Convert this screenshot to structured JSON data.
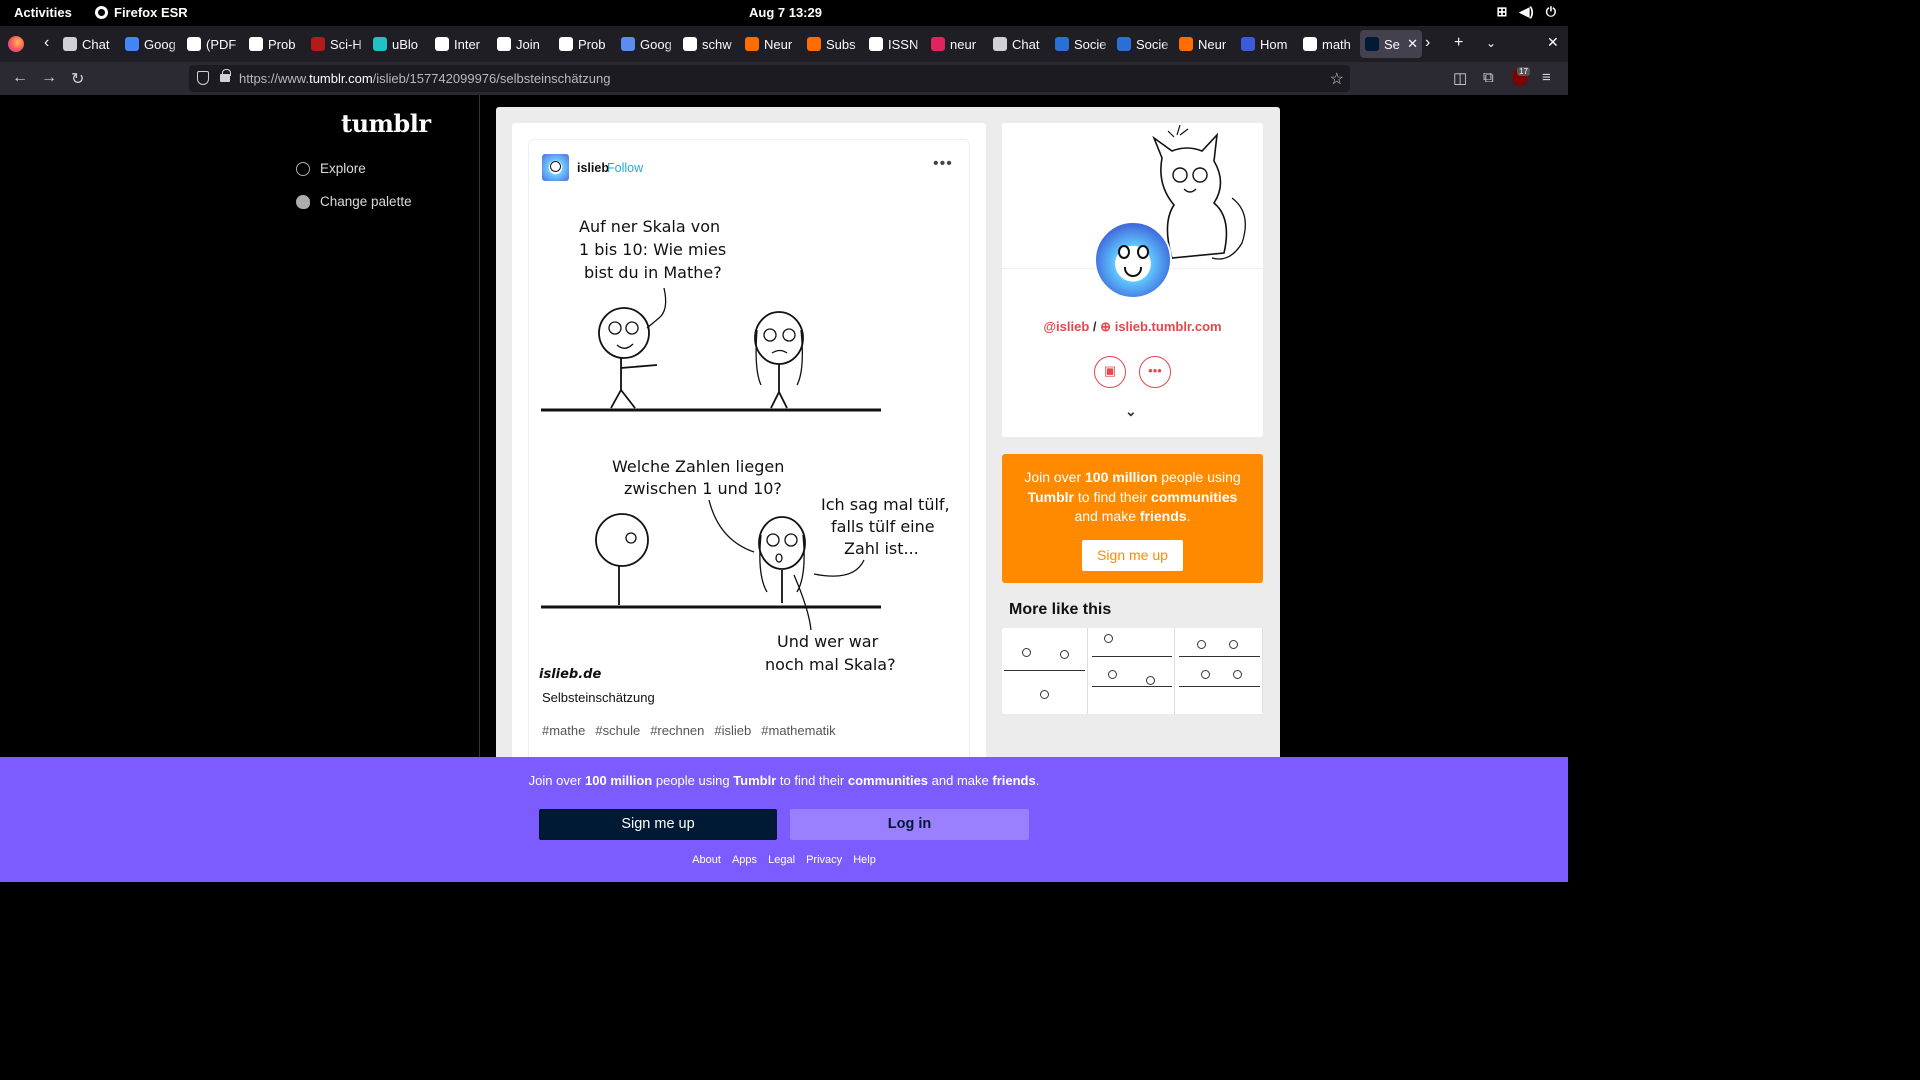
{
  "system": {
    "activities": "Activities",
    "app_name": "Firefox ESR",
    "clock": "Aug 7  13:29"
  },
  "browser": {
    "tabs": [
      {
        "label": "Chat",
        "color": "#d0d0d6"
      },
      {
        "label": "Goog",
        "color": "#4285f4"
      },
      {
        "label": "(PDF",
        "color": "#ffffff"
      },
      {
        "label": "Prob",
        "color": "#ffffff"
      },
      {
        "label": "Sci-H",
        "color": "#b31b1b"
      },
      {
        "label": "uBlo",
        "color": "#22c1c3"
      },
      {
        "label": "Inter",
        "color": "#ffffff"
      },
      {
        "label": "Join",
        "color": "#ffffff"
      },
      {
        "label": "Prob",
        "color": "#ffffff"
      },
      {
        "label": "Goog",
        "color": "#5b8def"
      },
      {
        "label": "schw",
        "color": "#ffffff"
      },
      {
        "label": "Neur",
        "color": "#ff6c00"
      },
      {
        "label": "Subs",
        "color": "#ff6c00"
      },
      {
        "label": "ISSN",
        "color": "#ffffff"
      },
      {
        "label": "neur",
        "color": "#e0245e"
      },
      {
        "label": "Chat",
        "color": "#d0d0d6"
      },
      {
        "label": "Socie",
        "color": "#2a6fd6"
      },
      {
        "label": "Socie",
        "color": "#2a6fd6"
      },
      {
        "label": "Neur",
        "color": "#ff6c00"
      },
      {
        "label": "Hom",
        "color": "#3b5bdb"
      },
      {
        "label": "math",
        "color": "#ffffff"
      },
      {
        "label": "Se",
        "color": "#001935",
        "active": true
      }
    ],
    "url_prefix": "https://www.",
    "url_domain": "tumblr.com",
    "url_path": "/islieb/157742099976/selbsteinschätzung",
    "ublock_count": "17"
  },
  "sidebar": {
    "logo": "tumblr",
    "items": [
      {
        "label": "Explore"
      },
      {
        "label": "Change palette"
      }
    ]
  },
  "post": {
    "username": "islieb",
    "follow_label": "Follow",
    "more": "•••",
    "comic": {
      "panel1_lines": [
        "Auf ner Skala von",
        "1 bis 10: Wie mies",
        "bist du in Mathe?"
      ],
      "panel2_q_lines": [
        "Welche Zahlen liegen",
        "zwischen 1 und 10?"
      ],
      "panel2_a_lines": [
        "Ich sag mal tülf,",
        "falls tülf eine",
        "Zahl ist..."
      ],
      "panel3_lines": [
        "Und wer war",
        "noch mal Skala?"
      ],
      "signature": "islieb.de"
    },
    "caption": "Selbsteinschätzung",
    "tags": [
      "#mathe",
      "#schule",
      "#rechnen",
      "#islieb",
      "#mathematik"
    ]
  },
  "profile": {
    "handle": "@islieb",
    "separator": "/",
    "site": "islieb.tumblr.com"
  },
  "promo": {
    "text_parts": [
      "Join over ",
      "100 million",
      " people using ",
      "Tumblr",
      " to find their ",
      "communities",
      " and make ",
      "friends",
      "."
    ],
    "signup_label": "Sign me up"
  },
  "more_like_this": {
    "title": "More like this"
  },
  "banner": {
    "text_parts": [
      "Join over ",
      "100 million",
      " people using ",
      "Tumblr",
      " to find their ",
      "communities",
      " and make ",
      "friends",
      "."
    ],
    "signup_label": "Sign me up",
    "login_label": "Log in",
    "links": [
      "About",
      "Apps",
      "Legal",
      "Privacy",
      "Help"
    ]
  }
}
